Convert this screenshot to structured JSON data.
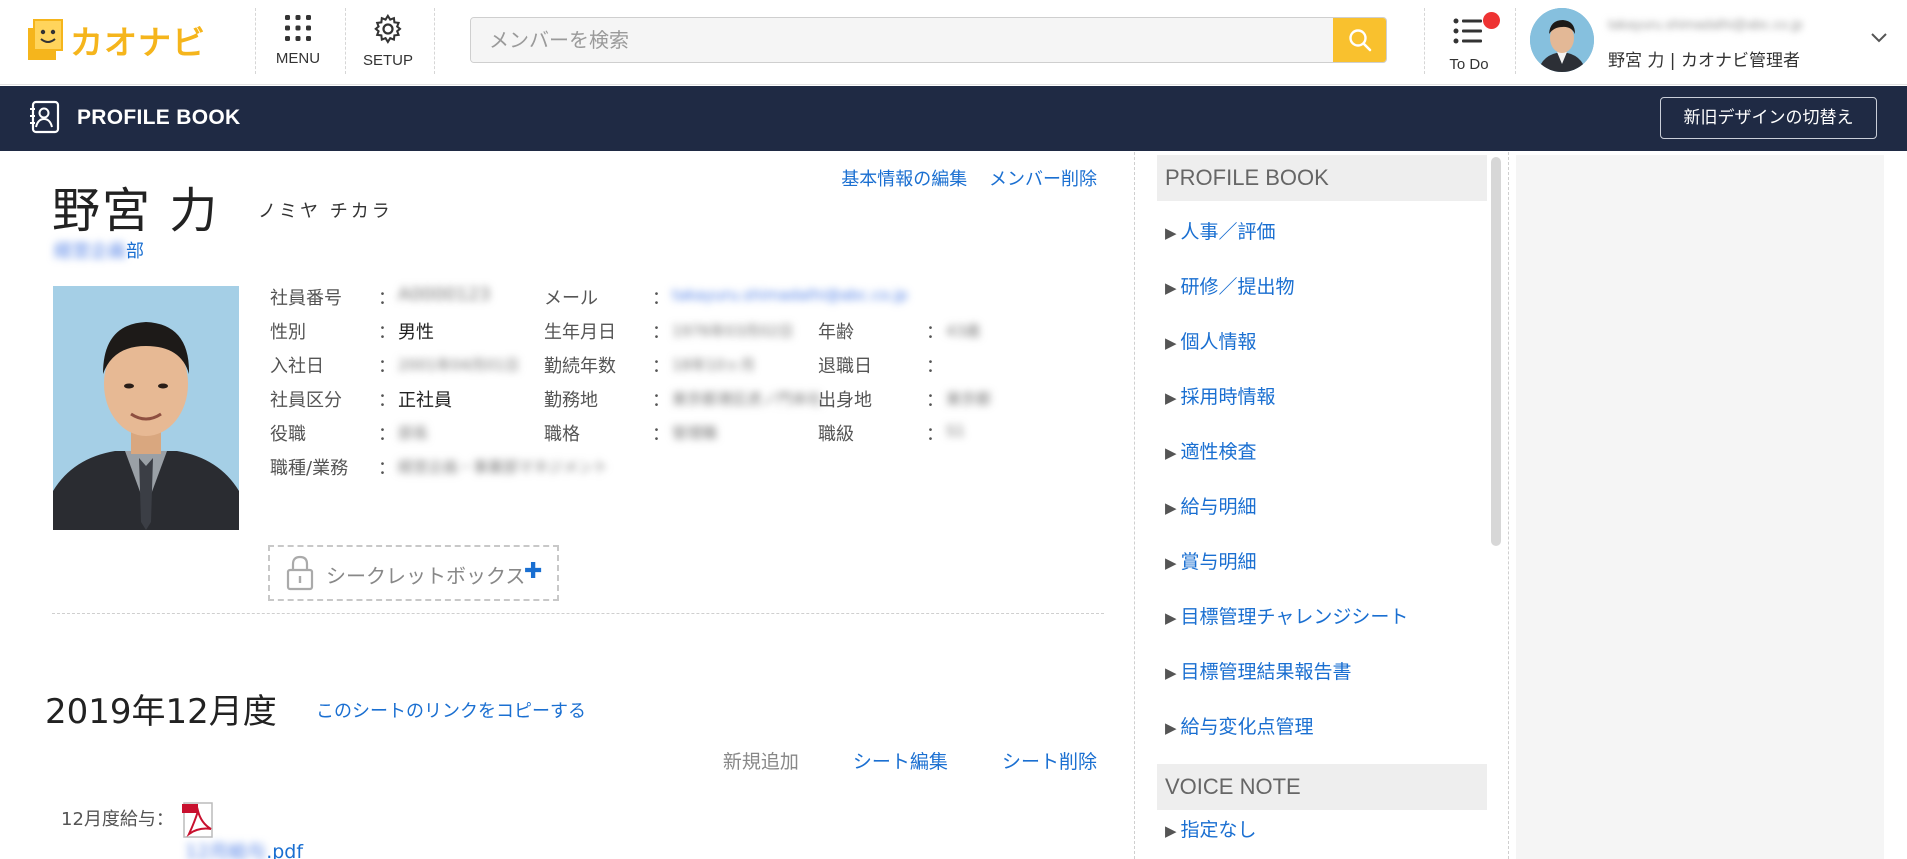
{
  "header": {
    "logo_text": "カオナビ",
    "menu_label": "MENU",
    "setup_label": "SETUP",
    "search_placeholder": "メンバーを検索",
    "todo_label": "To Do",
    "user_email": "takayuru.shimadalhi@abc.co.jp",
    "user_name": "野宮 力 | カオナビ管理者",
    "accent_color": "#f9c12e",
    "notification_color": "#ee3333"
  },
  "navbar": {
    "title": "PROFILE BOOK",
    "switch_button": "新旧デザインの切替え",
    "bg_color": "#1f2a44"
  },
  "profile": {
    "name": "野宮 力",
    "kana": "ノミヤ チカラ",
    "edit_link": "基本情報の編集",
    "delete_link": "メンバー削除",
    "dept_blurred": "経営企画",
    "dept_suffix": "部",
    "fields": [
      {
        "label": "社員番号",
        "value": "A0000123"
      },
      {
        "label": "メール",
        "value": "takayuru.shimadalhi@abc.co.jp"
      },
      {
        "label": "性別",
        "value": "男性"
      },
      {
        "label": "生年月日",
        "value": "1976年03月02日"
      },
      {
        "label": "年齢",
        "value": "43歳"
      },
      {
        "label": "入社日",
        "value": "2001年04月01日"
      },
      {
        "label": "勤続年数",
        "value": "18年10ヶ月"
      },
      {
        "label": "退職日",
        "value": ""
      },
      {
        "label": "社員区分",
        "value": "正社員"
      },
      {
        "label": "勤務地",
        "value": "東京都港区虎ノ門本社"
      },
      {
        "label": "出身地",
        "value": "東京都"
      },
      {
        "label": "役職",
        "value": "部長"
      },
      {
        "label": "職格",
        "value": "管理職"
      },
      {
        "label": "職級",
        "value": "S1"
      },
      {
        "label": "職種/業務",
        "value": "経営企画・事業部マネジメント"
      }
    ],
    "colon": "：",
    "secret_box": "シークレットボックス",
    "secret_plus": "✚"
  },
  "sheet": {
    "title": "2019年12月度",
    "copy_link": "このシートのリンクをコピーする",
    "add_label": "新規追加",
    "edit_label": "シート編集",
    "delete_label": "シート削除",
    "file_label": "12月度給与：",
    "file_name_blurred": "12月給与",
    "file_ext": ".pdf"
  },
  "sidebar": {
    "profile_heading": "PROFILE BOOK",
    "arrow": "▶",
    "items": [
      {
        "label": "人事／評価"
      },
      {
        "label": "研修／提出物"
      },
      {
        "label": "個人情報"
      },
      {
        "label": "採用時情報"
      },
      {
        "label": "適性検査"
      },
      {
        "label": "給与明細"
      },
      {
        "label": "賞与明細"
      },
      {
        "label": "目標管理チャレンジシート"
      },
      {
        "label": "目標管理結果報告書"
      },
      {
        "label": "給与変化点管理"
      }
    ],
    "voice_heading": "VOICE NOTE",
    "voice_items": [
      {
        "label": "指定なし"
      }
    ]
  }
}
